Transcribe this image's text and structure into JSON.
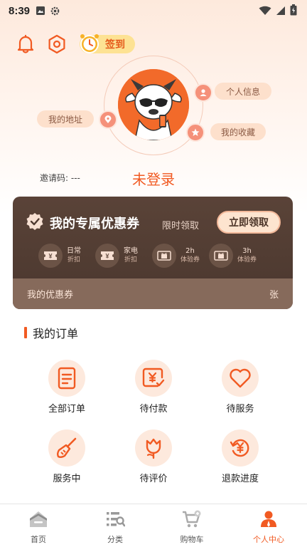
{
  "status_bar": {
    "time": "8:39"
  },
  "header": {
    "signin_label": "签到"
  },
  "profile": {
    "bubbles": {
      "info": "个人信息",
      "address": "我的地址",
      "favorites": "我的收藏"
    },
    "invite_label": "邀请码: ---",
    "login_label": "未登录"
  },
  "coupon": {
    "title": "我的专属优惠券",
    "subtitle": "限时领取",
    "claim_button": "立即领取",
    "types": [
      {
        "line1": "日常",
        "line2": "折扣",
        "icon": "yuan-ticket-icon"
      },
      {
        "line1": "家电",
        "line2": "折扣",
        "icon": "yuan-ticket-icon"
      },
      {
        "line1": "2h",
        "line2": "体验券",
        "icon": "gift-ticket-icon"
      },
      {
        "line1": "3h",
        "line2": "体验券",
        "icon": "gift-ticket-icon"
      }
    ],
    "my_coupons_label": "我的优惠券",
    "count_unit": "张"
  },
  "orders": {
    "title": "我的订单",
    "items": [
      {
        "label": "全部订单",
        "icon": "order-list-icon"
      },
      {
        "label": "待付款",
        "icon": "pending-payment-icon"
      },
      {
        "label": "待服务",
        "icon": "heart-icon"
      },
      {
        "label": "服务中",
        "icon": "broom-icon"
      },
      {
        "label": "待评价",
        "icon": "tulip-icon"
      },
      {
        "label": "退款进度",
        "icon": "refund-icon"
      }
    ]
  },
  "nav": {
    "tabs": [
      {
        "label": "首页",
        "icon": "home-icon"
      },
      {
        "label": "分类",
        "icon": "category-icon"
      },
      {
        "label": "购物车",
        "icon": "cart-icon"
      },
      {
        "label": "个人中心",
        "icon": "profile-icon",
        "active": true
      }
    ]
  },
  "colors": {
    "accent": "#f15a22",
    "coupon_bg": "#4f3a30",
    "soft": "#fde9dd"
  }
}
